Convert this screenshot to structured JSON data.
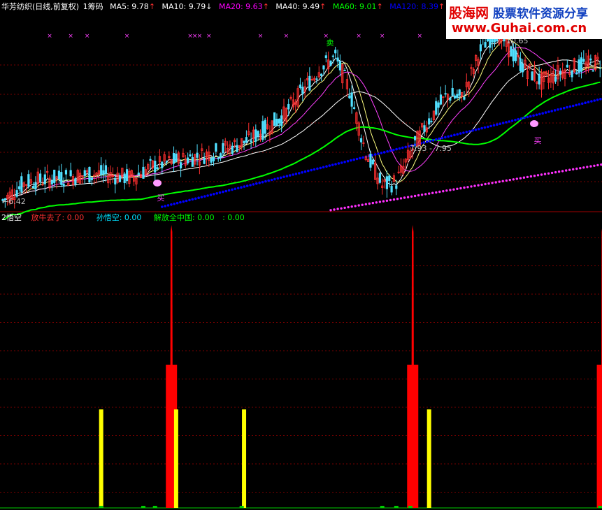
{
  "top_header": {
    "title": "华芳纺织(日线,前复权)",
    "chip_label": "1筹码",
    "ma": [
      {
        "label": "MA5: 9.78",
        "arrow": "↑",
        "arrow_dir": "up"
      },
      {
        "label": "MA10: 9.79",
        "arrow": "↓",
        "arrow_dir": "down"
      },
      {
        "label": "MA20: 9.63",
        "arrow": "↑",
        "arrow_dir": "up"
      },
      {
        "label": "MA40: 9.49",
        "arrow": "↑",
        "arrow_dir": "up"
      },
      {
        "label": "MA60: 9.01",
        "arrow": "↑",
        "arrow_dir": "up"
      },
      {
        "label": "MA120: 8.39",
        "arrow": "↑",
        "arrow_dir": "up"
      },
      {
        "label": "MA",
        "arrow": "",
        "arrow_dir": "none"
      }
    ]
  },
  "sub_header": {
    "title": "2悟空",
    "items": [
      {
        "label": "放牛去了: 0.00",
        "color": "#ff3030"
      },
      {
        "label": "孙悟空: 0.00",
        "color": "#00e0ff"
      },
      {
        "label": "解放全中国: 0.00",
        "color": "#00ff00"
      },
      {
        "label": ": 0.00",
        "color": "#00ff00"
      }
    ]
  },
  "watermark": {
    "brand": "股海网",
    "slogan": "股票软件资源分享",
    "url": "www.Guhai.com.cn"
  },
  "chart_data": [
    {
      "type": "candlestick",
      "annotations": {
        "high_label": "10.65",
        "low_label": "6.42",
        "range_label": "7.93 - 7.95",
        "buy_label": "买",
        "sell_label": "卖"
      },
      "colors": {
        "up": "#ff3030",
        "down": "#50e0ff",
        "ma5": "#ffffff",
        "ma10": "#ffff80",
        "ma20": "#ff40ff",
        "ma40": "#ffffff",
        "ma60": "#00ff00",
        "ma120": "#0000ff",
        "magenta_dots": "#ff30ff"
      },
      "ylim": [
        6.2,
        10.8
      ]
    },
    {
      "type": "bar",
      "series": [
        {
          "name": "放牛去了",
          "color": "#ff0000",
          "x_index": [
            72,
            175,
            256
          ],
          "values": [
            100,
            100,
            100
          ]
        },
        {
          "name": "孙悟空",
          "color": "#ffff00",
          "x_index": [
            42,
            74,
            103,
            182,
            258
          ],
          "values": [
            20,
            20,
            20,
            20,
            20
          ]
        }
      ]
    }
  ]
}
